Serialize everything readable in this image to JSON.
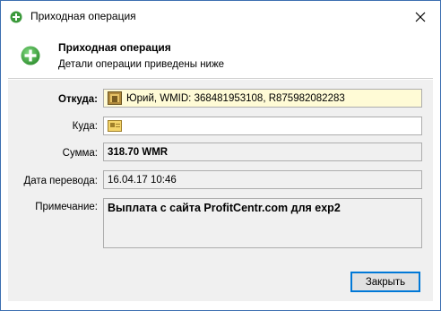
{
  "window": {
    "title": "Приходная операция"
  },
  "header": {
    "title": "Приходная операция",
    "subtitle": "Детали операции приведены ниже"
  },
  "form": {
    "from": {
      "label": "Откуда:",
      "value": "Юрий, WMID: 368481953108, R875982082283"
    },
    "to": {
      "label": "Куда:",
      "value": ""
    },
    "amount": {
      "label": "Сумма:",
      "value": "318.70 WMR"
    },
    "date": {
      "label": "Дата перевода:",
      "value": "16.04.17 10:46"
    },
    "note": {
      "label": "Примечание:",
      "value": "Выплата с сайта ProfitCentr.com для exp2"
    }
  },
  "footer": {
    "close_label": "Закрыть"
  },
  "icons": {
    "title_icon": "plus-circle-icon",
    "header_icon": "plus-circle-icon",
    "from_icon": "wm-passport-icon",
    "to_icon": "wallet-card-icon",
    "close_icon": "close-icon"
  },
  "colors": {
    "accent": "#3c9a3c",
    "field_highlight": "#fffbd6",
    "button_border": "#0078d7"
  }
}
